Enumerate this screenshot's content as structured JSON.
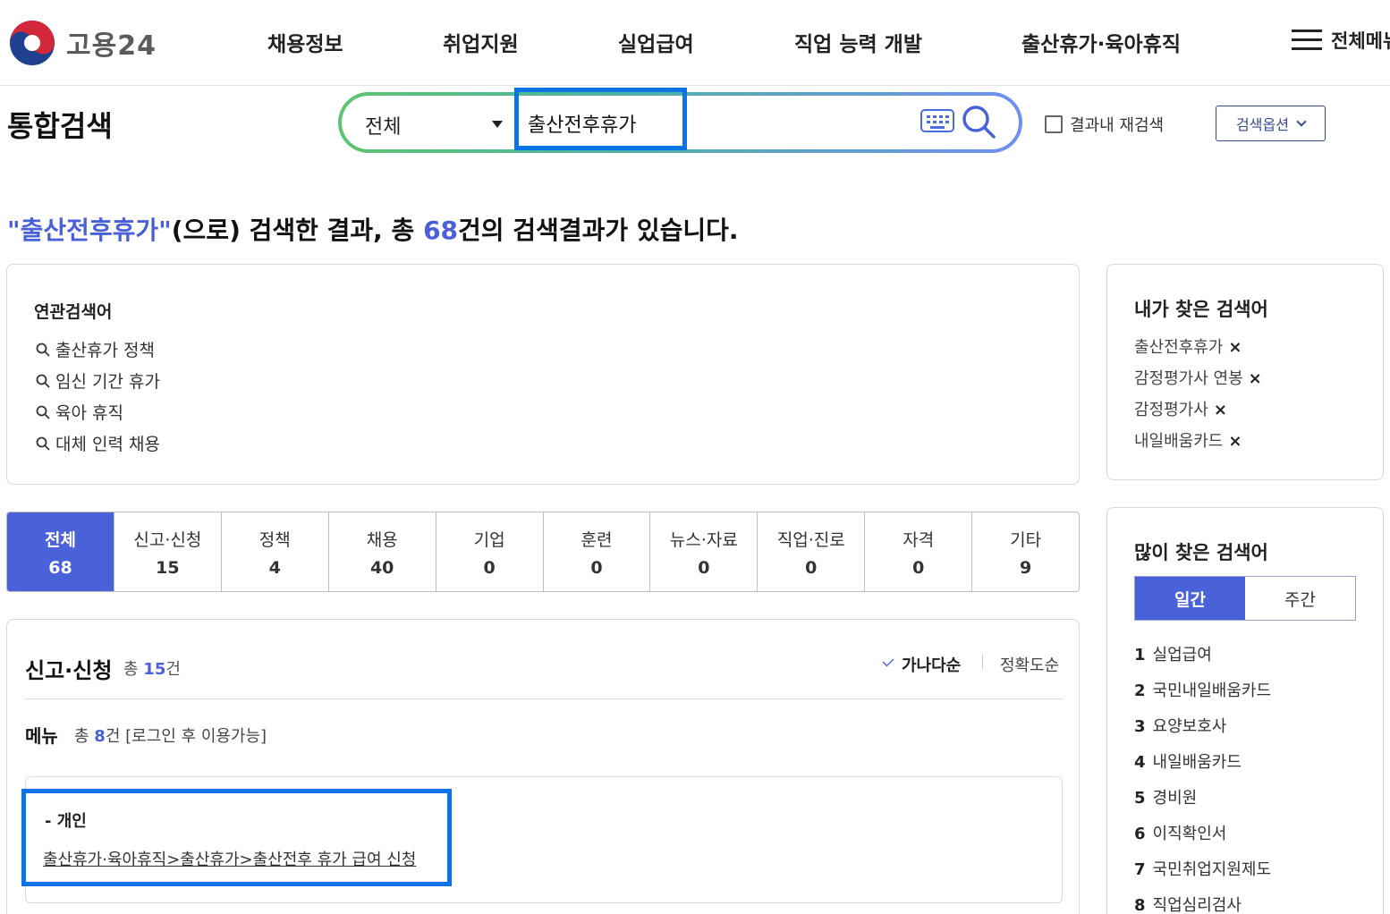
{
  "header": {
    "logo_text": "고용24",
    "nav": [
      "채용정보",
      "취업지원",
      "실업급여",
      "직업 능력 개발",
      "출산휴가·육아휴직"
    ],
    "all_menu_label": "전체메뉴"
  },
  "page_title": "통합검색",
  "search": {
    "scope": "전체",
    "query": "출산전후휴가",
    "recheck_label": "결과내 재검색",
    "options_label": "검색옵션"
  },
  "summary": {
    "keyword": "\"출산전후휴가\"",
    "mid": "(으로) 검색한 결과, 총 ",
    "count": "68",
    "tail": "건의 검색결과가 있습니다."
  },
  "related": {
    "title": "연관검색어",
    "items": [
      "출산휴가 정책",
      "임신 기간 휴가",
      "육아 휴직",
      "대체 인력 채용"
    ]
  },
  "tabs": [
    {
      "label": "전체",
      "count": "68"
    },
    {
      "label": "신고·신청",
      "count": "15"
    },
    {
      "label": "정책",
      "count": "4"
    },
    {
      "label": "채용",
      "count": "40"
    },
    {
      "label": "기업",
      "count": "0"
    },
    {
      "label": "훈련",
      "count": "0"
    },
    {
      "label": "뉴스·자료",
      "count": "0"
    },
    {
      "label": "직업·진로",
      "count": "0"
    },
    {
      "label": "자격",
      "count": "0"
    },
    {
      "label": "기타",
      "count": "9"
    }
  ],
  "result": {
    "section_title": "신고·신청",
    "total_prefix": "총 ",
    "total_count": "15",
    "total_suffix": "건",
    "sort_alpha": "가나다순",
    "sort_accuracy": "정확도순",
    "menu_title": "메뉴",
    "menu_total_prefix": "총 ",
    "menu_total_count": "8",
    "menu_total_suffix": "건 [로그인 후 이용가능]",
    "item_group": "- 개인",
    "item_path": "출산휴가·육아휴직>출산휴가>출산전후 휴가 급여 신청"
  },
  "recent": {
    "title": "내가 찾은 검색어",
    "items": [
      "출산전후휴가",
      "감정평가사 연봉",
      "감정평가사",
      "내일배움카드"
    ],
    "remove_symbol": "×"
  },
  "popular": {
    "title": "많이 찾은 검색어",
    "tab_daily": "일간",
    "tab_weekly": "주간",
    "items": [
      {
        "rank": "1",
        "text": "실업급여"
      },
      {
        "rank": "2",
        "text": "국민내일배움카드"
      },
      {
        "rank": "3",
        "text": "요양보호사"
      },
      {
        "rank": "4",
        "text": "내일배움카드"
      },
      {
        "rank": "5",
        "text": "경비원"
      },
      {
        "rank": "6",
        "text": "이직확인서"
      },
      {
        "rank": "7",
        "text": "국민취업지원제도"
      },
      {
        "rank": "8",
        "text": "직업심리검사"
      }
    ]
  },
  "colors": {
    "accent": "#4a62d9",
    "highlight_border": "#0a74e6",
    "gradient_start": "#5cc56e",
    "gradient_end": "#6f8ff0"
  }
}
